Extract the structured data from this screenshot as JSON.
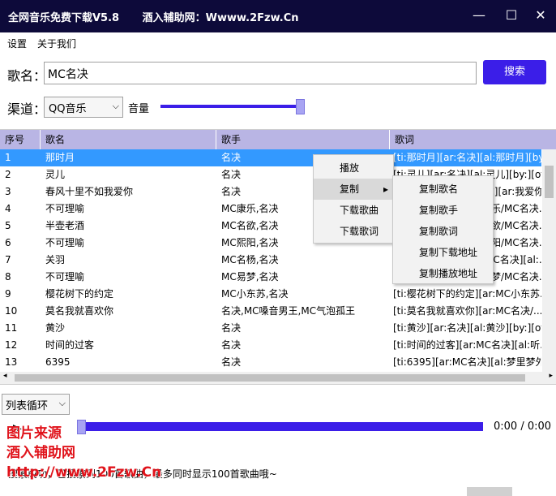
{
  "window": {
    "title": "全网音乐免费下载V5.8",
    "subtitle": "酒入辅助网：Wwww.2Fzw.Cn",
    "minimize": "—",
    "maximize": "☐",
    "close": "✕"
  },
  "menu": {
    "settings": "设置",
    "about": "关于我们"
  },
  "search": {
    "song_label": "歌名：",
    "song_value": "MC名决",
    "button": "搜索",
    "channel_label": "渠道：",
    "channel_value": "QQ音乐",
    "volume_label": "音量",
    "volume_level": 1.0
  },
  "table": {
    "headers": [
      "序号",
      "歌名",
      "歌手",
      "歌词"
    ],
    "rows": [
      {
        "no": "1",
        "name": "那时月",
        "artist": "名决",
        "lyric": "[ti:那时月][ar:名决][al:那时月][by:..."
      },
      {
        "no": "2",
        "name": "灵儿",
        "artist": "名决",
        "lyric": "[ti:灵儿][ar:名决][al:灵儿][by:][off..."
      },
      {
        "no": "3",
        "name": "春风十里不如我爱你",
        "artist": "名决",
        "lyric": "[ti:春风十里不如我爱你][ar:我爱你-..."
      },
      {
        "no": "4",
        "name": "不可理喻",
        "artist": "MC康乐,名决",
        "lyric": "[ti:不可理喻][ar:MC康乐/MC名决..."
      },
      {
        "no": "5",
        "name": "半壶老酒",
        "artist": "MC名欲,名决",
        "lyric": "[ti:半壶老酒][ar:MC名欲/MC名决..."
      },
      {
        "no": "6",
        "name": "不可理喻",
        "artist": "MC熙阳,名决",
        "lyric": "[ti:不可理喻][ar:MC熙阳/MC名决..."
      },
      {
        "no": "7",
        "name": "关羽",
        "artist": "MC名杨,名决",
        "lyric": "[ti:关羽][ar:MC名杨/MC名决][al:..."
      },
      {
        "no": "8",
        "name": "不可理喻",
        "artist": "MC易梦,名决",
        "lyric": "[ti:不可理喻][ar:MC易梦/MC名决..."
      },
      {
        "no": "9",
        "name": "樱花树下的约定",
        "artist": "MC小东苏,名决",
        "lyric": "[ti:樱花树下的约定][ar:MC小东苏..."
      },
      {
        "no": "10",
        "name": "莫名我就喜欢你",
        "artist": "名决,MC嗓音男王,MC气泡孤王",
        "lyric": "[ti:莫名我就喜欢你][ar:MC名决/..."
      },
      {
        "no": "11",
        "name": "黄沙",
        "artist": "名决",
        "lyric": "[ti:黄沙][ar:名决][al:黄沙][by:][off..."
      },
      {
        "no": "12",
        "name": "时间的过客",
        "artist": "名决",
        "lyric": "[ti:时间的过客][ar:MC名决][al:听..."
      },
      {
        "no": "13",
        "name": "6395",
        "artist": "名决",
        "lyric": "[ti:6395][ar:MC名决][al:梦里梦外..."
      }
    ]
  },
  "context_menu": {
    "items": [
      "播放",
      "复制",
      "下载歌曲",
      "下载歌词"
    ],
    "submenu_arrow": "▸",
    "submenu": [
      "复制歌名",
      "复制歌手",
      "复制歌词",
      "复制下载地址",
      "复制播放地址"
    ]
  },
  "player": {
    "loop_mode": "列表循环",
    "time": "0:00 / 0:00",
    "play_icon": "▶",
    "progress": 0.0
  },
  "status_text": "搜索成功，已搜索到100首歌曲，最多同时显示100首歌曲哦~",
  "watermark": {
    "line1": "图片来源",
    "line2": "酒入辅助网",
    "line3": "http://www.2Fzw.Cn"
  },
  "colors": {
    "titlebar": "#0d0a3a",
    "accent": "#3b1ee8",
    "header": "#b9b5e4",
    "selected_row": "#3399ff",
    "watermark": "#e0131b"
  }
}
